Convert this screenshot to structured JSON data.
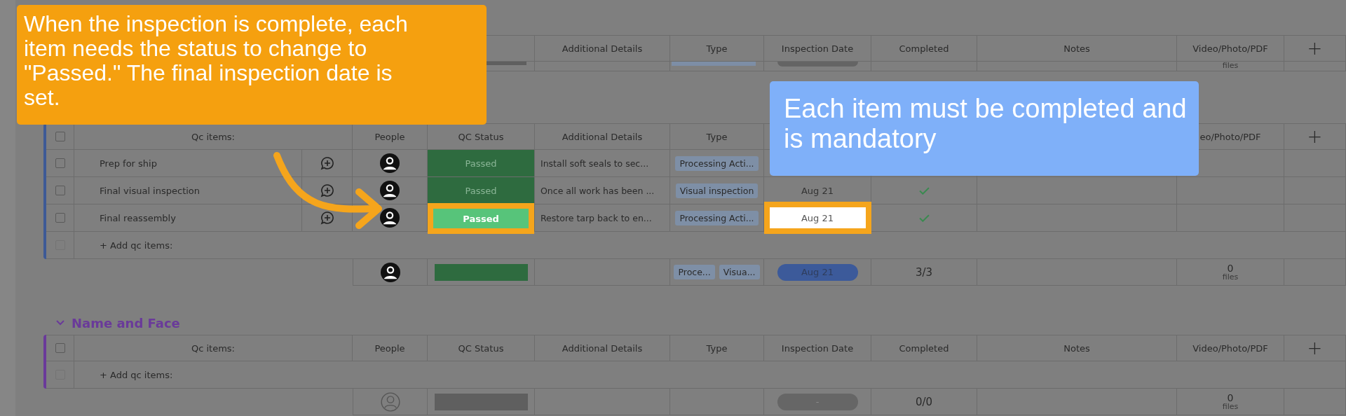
{
  "callouts": [
    {
      "kind": "orange",
      "text": "When the inspection is complete, each item needs the status to change to \"Passed.\" The final inspection date is set."
    },
    {
      "kind": "blue",
      "text": "Each item must be completed and is mandatory"
    }
  ],
  "groups": [
    {
      "kind": "partial",
      "header_end": [
        "Additional Details",
        "Type",
        "Inspection Date",
        "Completed",
        "Notes",
        "Video/Photo/PDF",
        "+"
      ],
      "files_label": "files"
    },
    {
      "kind": "full",
      "color": "#3d5a96",
      "header_checked": false,
      "header_start": [
        "Qc items:",
        "People",
        "QC Status",
        "Additional Details",
        "Type"
      ],
      "header_end": [
        "eo/Photo/PDF",
        "+"
      ],
      "rows": [
        {
          "checked": false,
          "name": "Prep for ship",
          "status": "Passed",
          "details": "Install soft seals to sec...",
          "type": "Processing Acti...",
          "highlighted": false
        },
        {
          "checked": false,
          "name": "Final visual inspection",
          "status": "Passed",
          "details": "Once all work has been ...",
          "type": "Visual inspection",
          "date": "Aug 21",
          "completed": true,
          "highlighted": false
        },
        {
          "checked": false,
          "name": "Final reassembly",
          "status": "Passed",
          "details": "Restore tarp back to en...",
          "type": "Processing Acti...",
          "date": "Aug 21",
          "completed": true,
          "highlighted": true
        }
      ],
      "add_row": {
        "label": "+ Add qc items:",
        "checked": false
      },
      "summary": {
        "assigned": true,
        "status_done": true,
        "types": [
          "Proce...",
          "Visua..."
        ],
        "date": "Aug 21",
        "date_set": true,
        "completed": "3/3",
        "files_count": "0",
        "files_label": "files"
      }
    },
    {
      "kind": "full",
      "title": "Name and Face",
      "color": "#6a3a9a",
      "header_checked": false,
      "header_start": [
        "Qc items:",
        "People",
        "QC Status",
        "Additional Details",
        "Type",
        "Inspection Date",
        "Completed",
        "Notes",
        "Video/Photo/PDF",
        "+"
      ],
      "add_row": {
        "label": "+ Add qc items:",
        "checked": false
      },
      "summary": {
        "assigned": false,
        "status_done": false,
        "date": "-",
        "date_set": false,
        "completed": "0/0",
        "files_count": "0",
        "files_label": "files"
      }
    }
  ]
}
